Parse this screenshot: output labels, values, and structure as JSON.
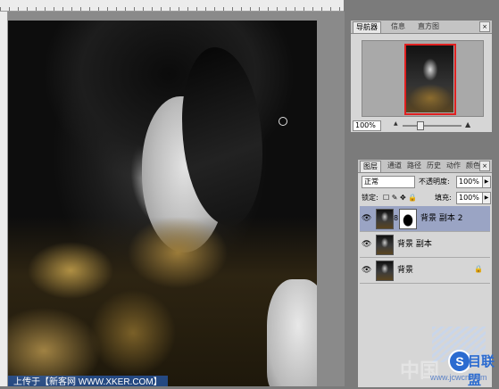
{
  "watermark": "上传于【新客网 WWW.XKER.COM】",
  "navigator": {
    "tabs": [
      "导航器",
      "信息",
      "直方图"
    ],
    "active_tab": 0,
    "zoom": "100%",
    "close_glyph": "×",
    "mtn_small": "▲",
    "mtn_large": "▲"
  },
  "layers": {
    "tabs": [
      "图层",
      "通道",
      "路径",
      "历史",
      "动作",
      "颜色"
    ],
    "active_tab": 0,
    "close_glyph": "×",
    "blend_mode": "正常",
    "opacity_label": "不透明度:",
    "opacity_value": "100%",
    "lock_label": "锁定:",
    "lock_icons": "☐ ✎ ✥ 🔒",
    "fill_label": "填充:",
    "fill_value": "100%",
    "arrow": "▶",
    "eye_glyph": "👁",
    "chain_glyph": "8",
    "lock_glyph": "🔒",
    "items": [
      {
        "name": "背景 副本 2",
        "selected": true,
        "has_mask": true
      },
      {
        "name": "背景 副本",
        "selected": false,
        "has_mask": false
      },
      {
        "name": "背景",
        "selected": false,
        "has_mask": false,
        "locked": true
      }
    ]
  },
  "brand": {
    "initial": "S",
    "name": "目联盟",
    "watermark_zh": "中国",
    "url": "www.jcwcn.com"
  }
}
